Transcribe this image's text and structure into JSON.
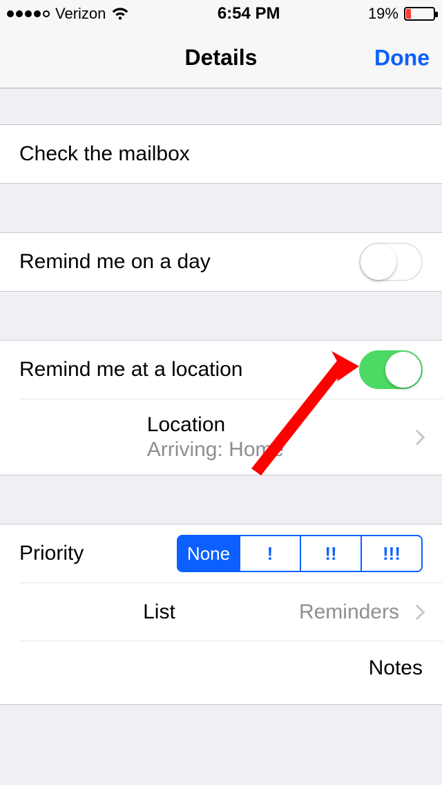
{
  "statusbar": {
    "carrier": "Verizon",
    "time": "6:54 PM",
    "battery_percent": "19%"
  },
  "nav": {
    "title": "Details",
    "done": "Done"
  },
  "reminder": {
    "title": "Check the mailbox"
  },
  "remind_day": {
    "label": "Remind me on a day",
    "on": false
  },
  "remind_location": {
    "label": "Remind me at a location",
    "on": true,
    "location_label": "Location",
    "location_value": "Arriving: Home"
  },
  "priority": {
    "label": "Priority",
    "options": [
      "None",
      "!",
      "!!",
      "!!!"
    ],
    "selected_index": 0
  },
  "list": {
    "label": "List",
    "value": "Reminders"
  },
  "notes": {
    "label": "Notes"
  }
}
